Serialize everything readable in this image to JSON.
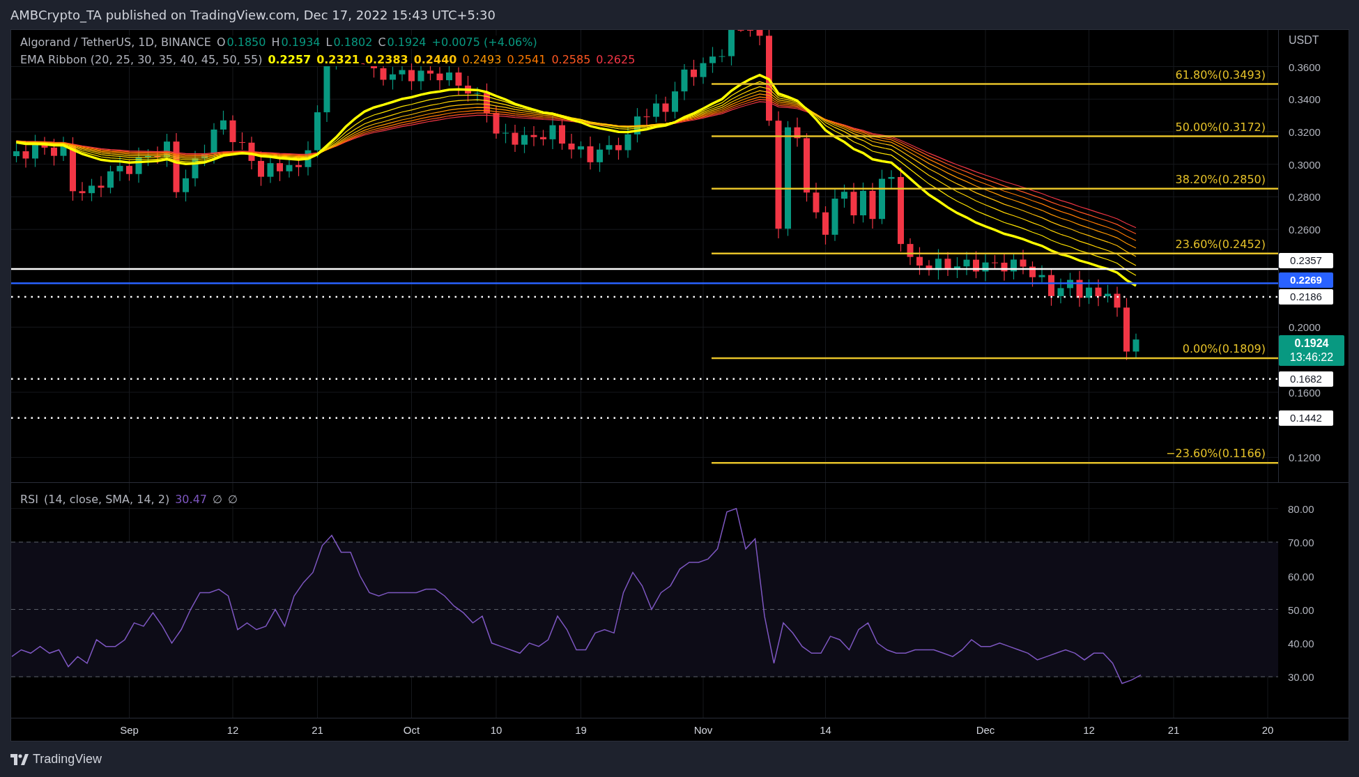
{
  "header": {
    "text": "AMBCrypto_TA published on TradingView.com, Dec 17, 2022 15:43 UTC+5:30"
  },
  "legend": {
    "symbol": "Algorand / TetherUS, 1D, BINANCE",
    "ohlc": [
      {
        "key": "O",
        "value": "0.1850"
      },
      {
        "key": "H",
        "value": "0.1934"
      },
      {
        "key": "L",
        "value": "0.1802"
      },
      {
        "key": "C",
        "value": "0.1924"
      }
    ],
    "change": "+0.0075 (+4.06%)"
  },
  "ema_ribbon": {
    "label": "EMA Ribbon (20, 25, 30, 35, 40, 45, 50, 55)",
    "values": [
      {
        "value": "0.2257",
        "color": "#ffff00"
      },
      {
        "value": "0.2321",
        "color": "#ffe600"
      },
      {
        "value": "0.2383",
        "color": "#ffd500"
      },
      {
        "value": "0.2440",
        "color": "#ffc107"
      },
      {
        "value": "0.2493",
        "color": "#ff9800"
      },
      {
        "value": "0.2541",
        "color": "#ff7a00"
      },
      {
        "value": "0.2585",
        "color": "#ff5722"
      },
      {
        "value": "0.2625",
        "color": "#f23645"
      }
    ]
  },
  "price_axis": {
    "unit": "USDT",
    "ticks": [
      "0.3600",
      "0.3400",
      "0.3200",
      "0.3000",
      "0.2800",
      "0.2600",
      "0.2000",
      "0.1600",
      "0.1200"
    ]
  },
  "fib_levels": [
    {
      "label": "61.80%(0.3493)"
    },
    {
      "label": "50.00%(0.3172)"
    },
    {
      "label": "38.20%(0.2850)"
    },
    {
      "label": "23.60%(0.2452)"
    },
    {
      "label": "0.00%(0.1809)"
    },
    {
      "label": "−23.60%(0.1166)"
    }
  ],
  "levels": [
    {
      "label": "0.2357",
      "kind": "solid"
    },
    {
      "label": "0.2269",
      "kind": "highlight"
    },
    {
      "label": "0.2186",
      "kind": "dotted"
    },
    {
      "label": "0.1682",
      "kind": "dotted"
    },
    {
      "label": "0.1442",
      "kind": "dotted"
    }
  ],
  "last_price": {
    "price": "0.1924",
    "countdown": "13:46:22"
  },
  "rsi": {
    "label": "(14, close, SMA, 14, 2)",
    "value": "30.47",
    "extras": [
      "∅",
      "∅"
    ],
    "chart_data": {
      "type": "line",
      "grid": true,
      "ylim": [
        17.8,
        87.6
      ],
      "yticks": [
        {
          "value": 80,
          "label": "80.00"
        },
        {
          "value": 70,
          "label": "70.00"
        },
        {
          "value": 60,
          "label": "60.00"
        },
        {
          "value": 50,
          "label": "50.00"
        },
        {
          "value": 40,
          "label": "40.00"
        },
        {
          "value": 30,
          "label": "30.00"
        }
      ],
      "series": [
        {
          "name": "RSI",
          "color": "#7e57c2",
          "values": [
            36,
            38,
            37,
            39,
            37,
            38,
            33,
            36,
            34,
            41,
            39,
            39,
            41,
            46,
            45,
            49,
            45,
            40,
            44,
            50,
            55,
            55,
            56,
            54,
            44,
            46,
            44,
            45,
            50,
            45,
            54,
            58,
            61,
            69,
            72,
            67,
            67,
            60,
            55,
            54,
            55,
            55,
            55,
            55,
            56,
            56,
            54,
            51,
            49,
            46,
            48,
            40,
            39,
            38,
            37,
            40,
            39,
            41,
            48,
            44,
            38,
            38,
            43,
            44,
            43,
            55,
            61,
            57,
            50,
            55,
            57,
            62,
            64,
            64,
            65,
            68,
            79,
            80,
            68,
            71,
            48,
            34,
            46,
            43,
            39,
            37,
            37,
            42,
            41,
            38,
            44,
            46,
            40,
            38,
            37,
            37,
            38,
            38,
            38,
            37,
            36,
            38,
            41,
            39,
            39,
            40,
            39,
            38,
            37,
            35,
            36,
            37,
            38,
            37,
            35,
            37,
            37,
            34,
            28,
            29,
            30.5
          ]
        }
      ]
    }
  },
  "time_axis": {
    "labels": [
      "Sep",
      "12",
      "21",
      "Oct",
      "10",
      "19",
      "Nov",
      "14",
      "Dec",
      "12",
      "21",
      "20"
    ]
  },
  "footer": {
    "brand": "TradingView"
  }
}
